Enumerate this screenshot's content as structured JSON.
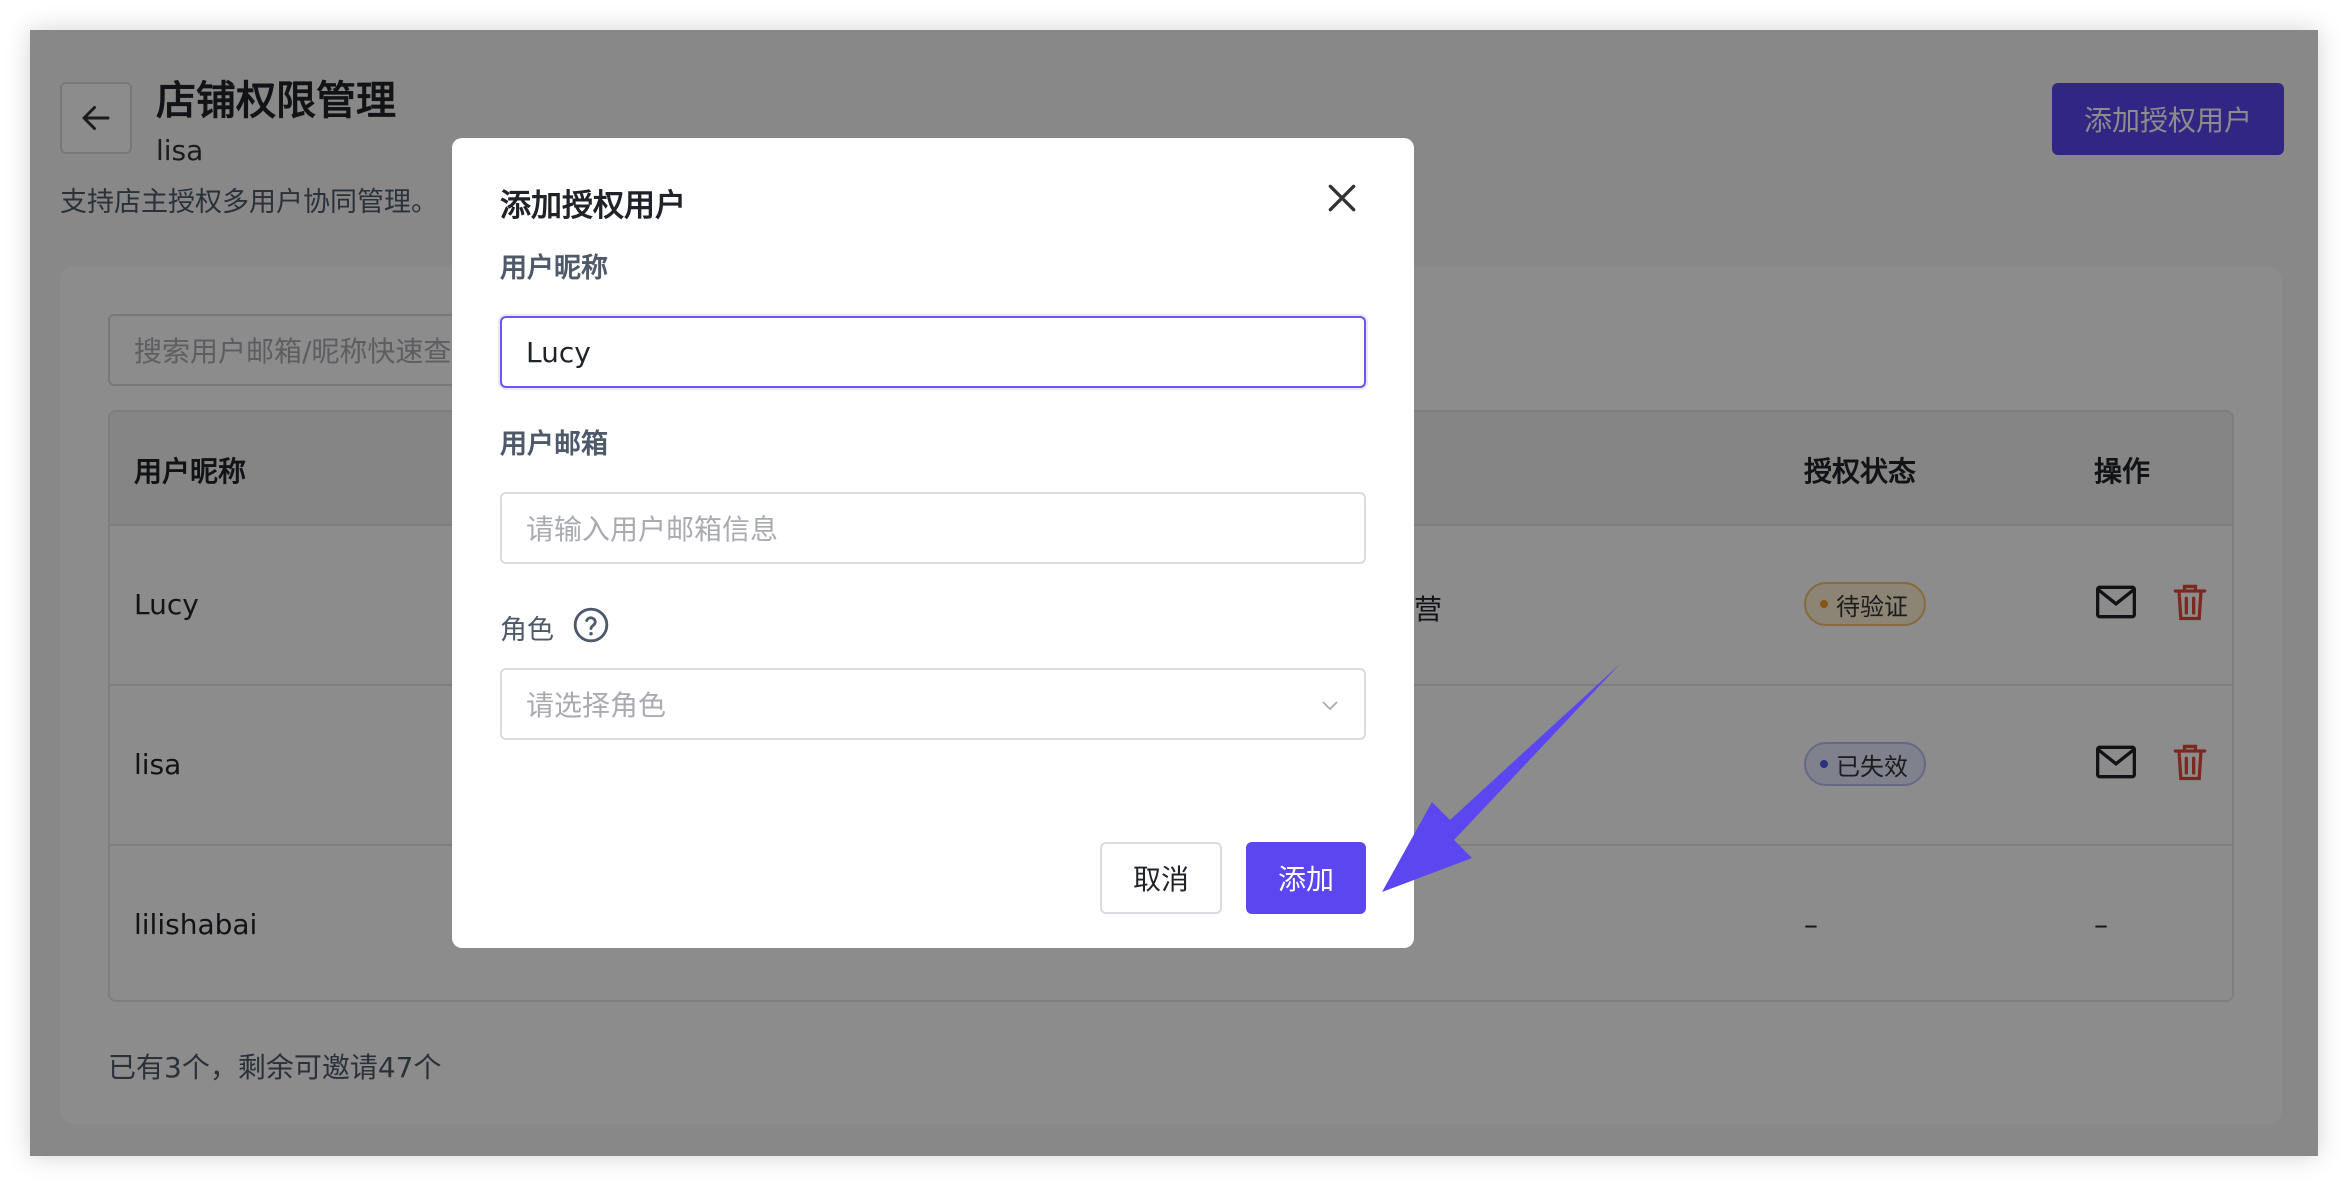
{
  "header": {
    "title": "店铺权限管理",
    "subtitle": "lisa",
    "description": "支持店主授权多用户协同管理。",
    "add_button_label": "添加授权用户"
  },
  "search": {
    "placeholder": "搜索用户邮箱/昵称快速查"
  },
  "table": {
    "columns": {
      "nickname": "用户昵称",
      "status": "授权状态",
      "actions": "操作"
    },
    "rows": [
      {
        "nickname": "Lucy",
        "role_fragment": "营",
        "status": "待验证"
      },
      {
        "nickname": "lisa",
        "status": "已失效"
      },
      {
        "nickname": "lilishabai",
        "status": "–",
        "actions": "–"
      }
    ]
  },
  "footer": {
    "count_text": "已有3个，剩余可邀请47个"
  },
  "modal": {
    "title": "添加授权用户",
    "nickname_label": "用户昵称",
    "nickname_value": "Lucy",
    "email_label": "用户邮箱",
    "email_placeholder": "请输入用户邮箱信息",
    "role_label": "角色",
    "role_placeholder": "请选择角色",
    "cancel_label": "取消",
    "add_label": "添加"
  },
  "colors": {
    "primary": "#5b46f0",
    "danger": "#e5483a",
    "arrow": "#5b46f0"
  }
}
